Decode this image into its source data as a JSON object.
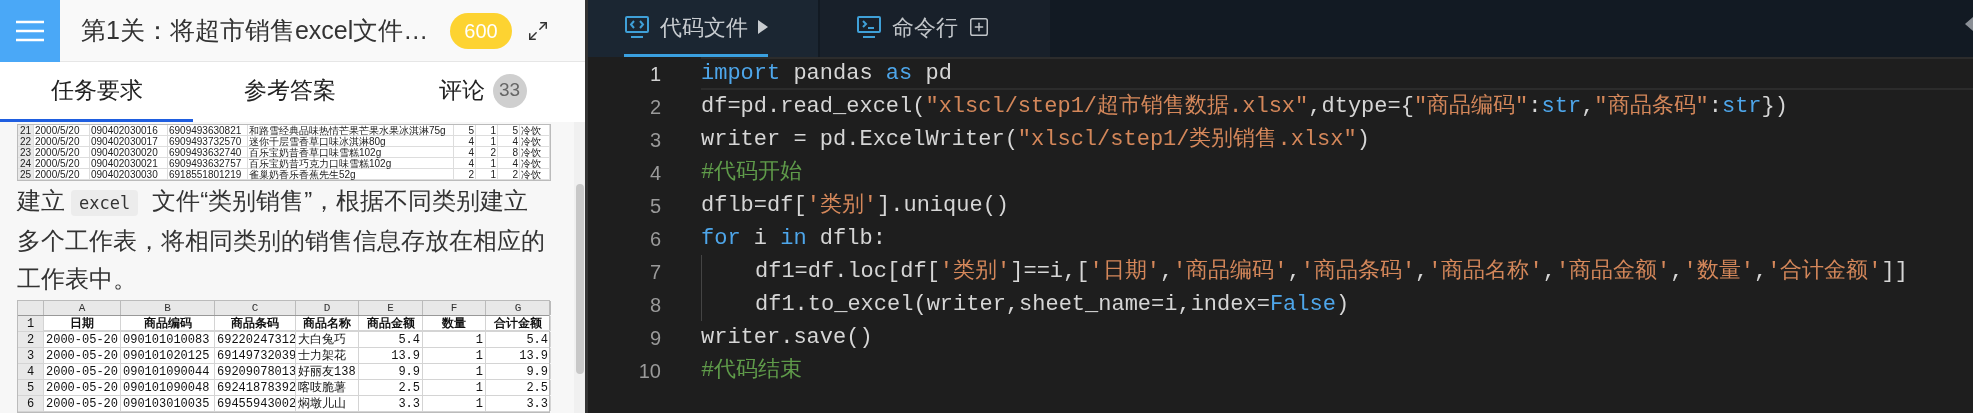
{
  "task_panel": {
    "title": "第1关：将超市销售excel文件…",
    "score": "600",
    "tabs": [
      {
        "label": "任务要求",
        "selected": true
      },
      {
        "label": "参考答案",
        "selected": false
      },
      {
        "label": "评论",
        "badge": "33",
        "selected": false
      }
    ],
    "top_table": {
      "rows": [
        [
          "21",
          "2000/5/20",
          "090402030016",
          "6909493630821",
          "和路雪经典品味热情芒果芒果水果冰淇淋75g",
          "5",
          "1",
          "5",
          "冷饮"
        ],
        [
          "22",
          "2000/5/20",
          "090402030017",
          "6909493732570",
          "迷你千层雪香草口味冰淇淋80g",
          "4",
          "1",
          "4",
          "冷饮"
        ],
        [
          "23",
          "2000/5/20",
          "090402030020",
          "6909493632740",
          "百乐宝奶昔香草口味雪糕102g",
          "4",
          "2",
          "8",
          "冷饮"
        ],
        [
          "24",
          "2000/5/20",
          "090402030021",
          "6909493632757",
          "百乐宝奶昔巧克力口味雪糕102g",
          "4",
          "1",
          "4",
          "冷饮"
        ],
        [
          "25",
          "2000/5/20",
          "090402030030",
          "6918551801219",
          "雀巢奶香乐香蕉先生52g",
          "2",
          "1",
          "2",
          "冷饮"
        ]
      ]
    },
    "paragraph": [
      {
        "kind": "text",
        "text": "建立"
      },
      {
        "kind": "code",
        "text": "excel"
      },
      {
        "kind": "text",
        "text": "文件“类别销售”，根据不同类别建立多个工作表，将相同类别的销售信息存放在相应的工作表中。"
      }
    ],
    "sheet": {
      "columns": [
        "",
        "A",
        "B",
        "C",
        "D",
        "E",
        "F",
        "G"
      ],
      "rows": [
        [
          "1",
          "日期",
          "商品编码",
          "商品条码",
          "商品名称",
          "商品金额",
          "数量",
          "合计金额"
        ],
        [
          "2",
          "2000-05-20",
          "090101010083",
          "69220247312",
          "大白兔巧",
          "5.4",
          "1",
          "5.4"
        ],
        [
          "3",
          "2000-05-20",
          "090101020125",
          "69149732039",
          "士力架花",
          "13.9",
          "1",
          "13.9"
        ],
        [
          "4",
          "2000-05-20",
          "090101090044",
          "69209078013",
          "好丽友138",
          "9.9",
          "1",
          "9.9"
        ],
        [
          "5",
          "2000-05-20",
          "090101090048",
          "69241878392",
          "喀吱脆薯",
          "2.5",
          "1",
          "2.5"
        ],
        [
          "6",
          "2000-05-20",
          "090103010035",
          "69455943002",
          "焖墩儿山",
          "3.3",
          "1",
          "3.3"
        ]
      ]
    }
  },
  "editor": {
    "tabs": [
      {
        "label": "代码文件",
        "kind": "file",
        "selected": true
      },
      {
        "label": "命令行",
        "kind": "terminal",
        "selected": false
      }
    ],
    "lines": [
      {
        "number": "1",
        "current": true,
        "indented": false,
        "tokens": [
          {
            "kind": "keyword",
            "text": "import"
          },
          {
            "kind": "plain",
            "text": " pandas "
          },
          {
            "kind": "keyword",
            "text": "as"
          },
          {
            "kind": "plain",
            "text": " pd"
          }
        ]
      },
      {
        "number": "2",
        "current": false,
        "indented": false,
        "tokens": [
          {
            "kind": "plain",
            "text": "df=pd.read_excel("
          },
          {
            "kind": "string",
            "text": "\"xlscl/step1/超市销售数据.xlsx\""
          },
          {
            "kind": "plain",
            "text": ",dtype={"
          },
          {
            "kind": "string",
            "text": "\"商品编码\""
          },
          {
            "kind": "plain",
            "text": ":"
          },
          {
            "kind": "keyword",
            "text": "str"
          },
          {
            "kind": "plain",
            "text": ","
          },
          {
            "kind": "string",
            "text": "\"商品条码\""
          },
          {
            "kind": "plain",
            "text": ":"
          },
          {
            "kind": "keyword",
            "text": "str"
          },
          {
            "kind": "plain",
            "text": "})"
          }
        ]
      },
      {
        "number": "3",
        "current": false,
        "indented": false,
        "tokens": [
          {
            "kind": "plain",
            "text": "writer = pd.ExcelWriter("
          },
          {
            "kind": "string",
            "text": "\"xlscl/step1/类别销售.xlsx\""
          },
          {
            "kind": "plain",
            "text": ")"
          }
        ]
      },
      {
        "number": "4",
        "current": false,
        "indented": false,
        "tokens": [
          {
            "kind": "comment",
            "text": "#代码开始"
          }
        ]
      },
      {
        "number": "5",
        "current": false,
        "indented": false,
        "tokens": [
          {
            "kind": "plain",
            "text": "dflb=df["
          },
          {
            "kind": "string",
            "text": "'类别'"
          },
          {
            "kind": "plain",
            "text": "].unique()"
          }
        ]
      },
      {
        "number": "6",
        "current": false,
        "indented": false,
        "tokens": [
          {
            "kind": "keyword",
            "text": "for"
          },
          {
            "kind": "plain",
            "text": " i "
          },
          {
            "kind": "keyword",
            "text": "in"
          },
          {
            "kind": "plain",
            "text": " dflb:"
          }
        ]
      },
      {
        "number": "7",
        "current": false,
        "indented": true,
        "tokens": [
          {
            "kind": "plain",
            "text": "df1=df.loc[df["
          },
          {
            "kind": "string",
            "text": "'类别'"
          },
          {
            "kind": "plain",
            "text": "]==i,["
          },
          {
            "kind": "string",
            "text": "'日期'"
          },
          {
            "kind": "plain",
            "text": ","
          },
          {
            "kind": "string",
            "text": "'商品编码'"
          },
          {
            "kind": "plain",
            "text": ","
          },
          {
            "kind": "string",
            "text": "'商品条码'"
          },
          {
            "kind": "plain",
            "text": ","
          },
          {
            "kind": "string",
            "text": "'商品名称'"
          },
          {
            "kind": "plain",
            "text": ","
          },
          {
            "kind": "string",
            "text": "'商品金额'"
          },
          {
            "kind": "plain",
            "text": ","
          },
          {
            "kind": "string",
            "text": "'数量'"
          },
          {
            "kind": "plain",
            "text": ","
          },
          {
            "kind": "string",
            "text": "'合计金额'"
          },
          {
            "kind": "plain",
            "text": "]]"
          }
        ]
      },
      {
        "number": "8",
        "current": false,
        "indented": true,
        "tokens": [
          {
            "kind": "plain",
            "text": "df1.to_excel(writer,sheet_name=i,index="
          },
          {
            "kind": "keyword",
            "text": "False"
          },
          {
            "kind": "plain",
            "text": ")"
          }
        ]
      },
      {
        "number": "9",
        "current": false,
        "indented": false,
        "tokens": [
          {
            "kind": "plain",
            "text": "writer.save()"
          }
        ]
      },
      {
        "number": "10",
        "current": false,
        "indented": false,
        "tokens": [
          {
            "kind": "comment",
            "text": "#代码结束"
          }
        ]
      }
    ]
  }
}
